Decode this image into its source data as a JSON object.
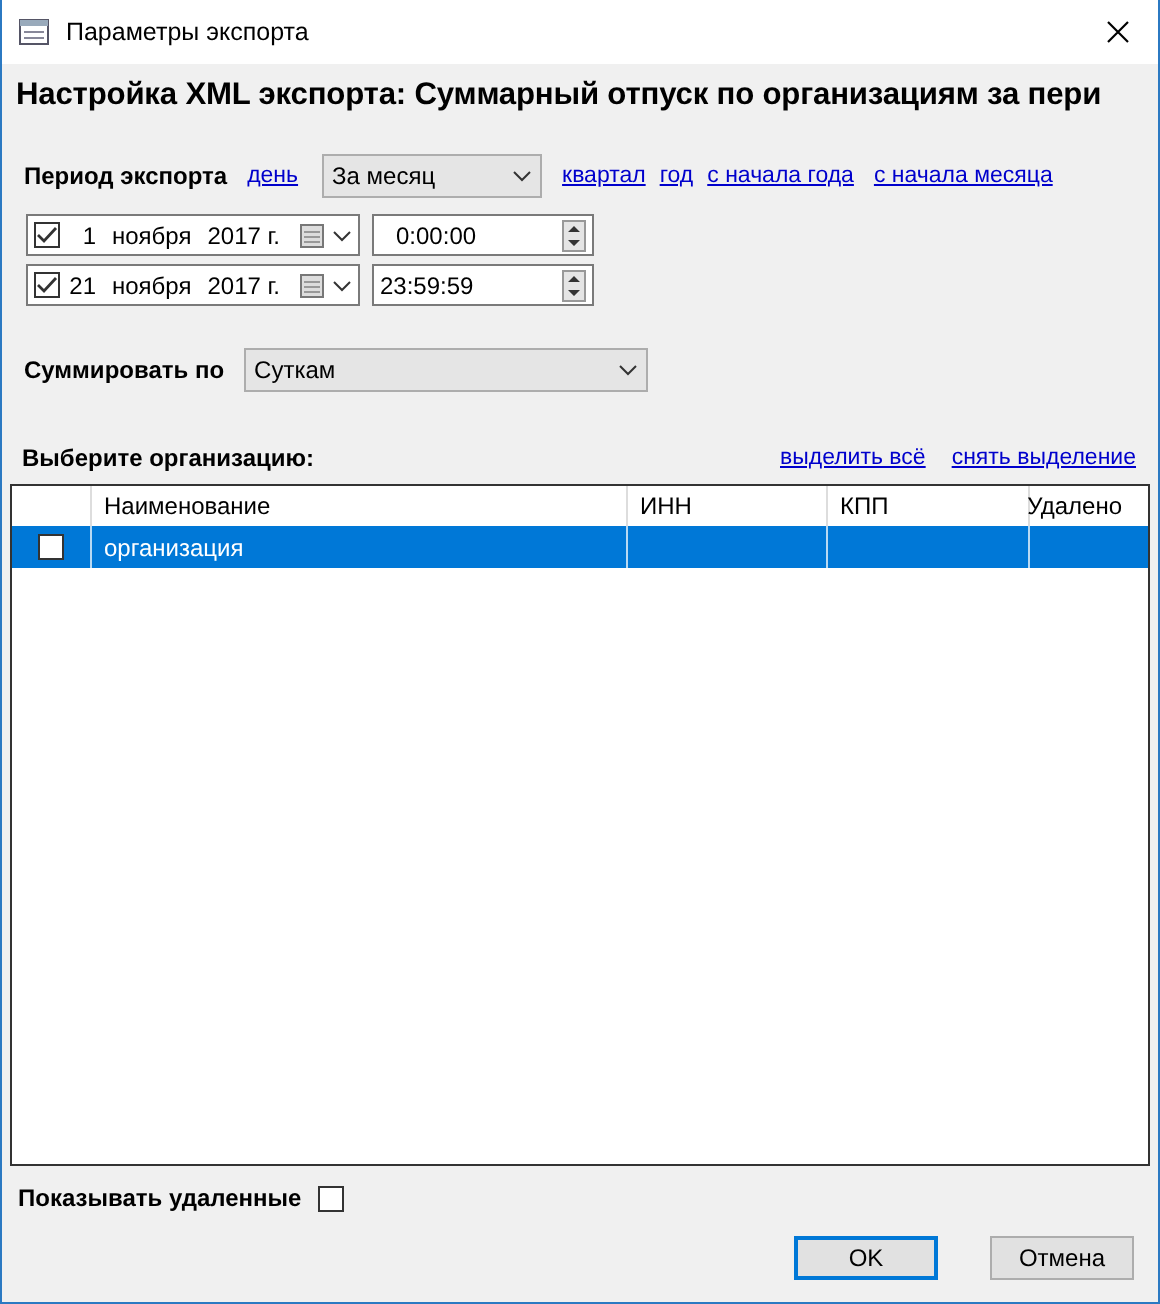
{
  "window": {
    "title": "Параметры экспорта"
  },
  "heading": "Настройка XML экспорта: Суммарный отпуск по организациям за пери",
  "period": {
    "label": "Период экспорта",
    "links_before": [
      "день"
    ],
    "select": "За месяц",
    "links_after": [
      "квартал",
      "год",
      "с начала года",
      "с начала месяца"
    ]
  },
  "dates": [
    {
      "checked": true,
      "day": "1",
      "month": "ноября",
      "year": "2017 г.",
      "time": "0:00:00"
    },
    {
      "checked": true,
      "day": "21",
      "month": "ноября",
      "year": "2017 г.",
      "time": "23:59:59"
    }
  ],
  "sum_by": {
    "label": "Суммировать по",
    "value": "Суткам"
  },
  "org": {
    "label": "Выберите организацию:",
    "links": [
      "выделить всё",
      "снять выделение"
    ]
  },
  "table": {
    "columns": [
      "Наименование",
      "ИНН",
      "КПП",
      "Удалено"
    ],
    "rows": [
      {
        "selected": true,
        "checked": false,
        "cells": [
          "организация",
          "",
          "",
          ""
        ]
      }
    ]
  },
  "show_deleted": {
    "label": "Показывать удаленные",
    "checked": false
  },
  "buttons": [
    {
      "label": "OK",
      "default": true
    },
    {
      "label": "Отмена",
      "default": false
    }
  ]
}
